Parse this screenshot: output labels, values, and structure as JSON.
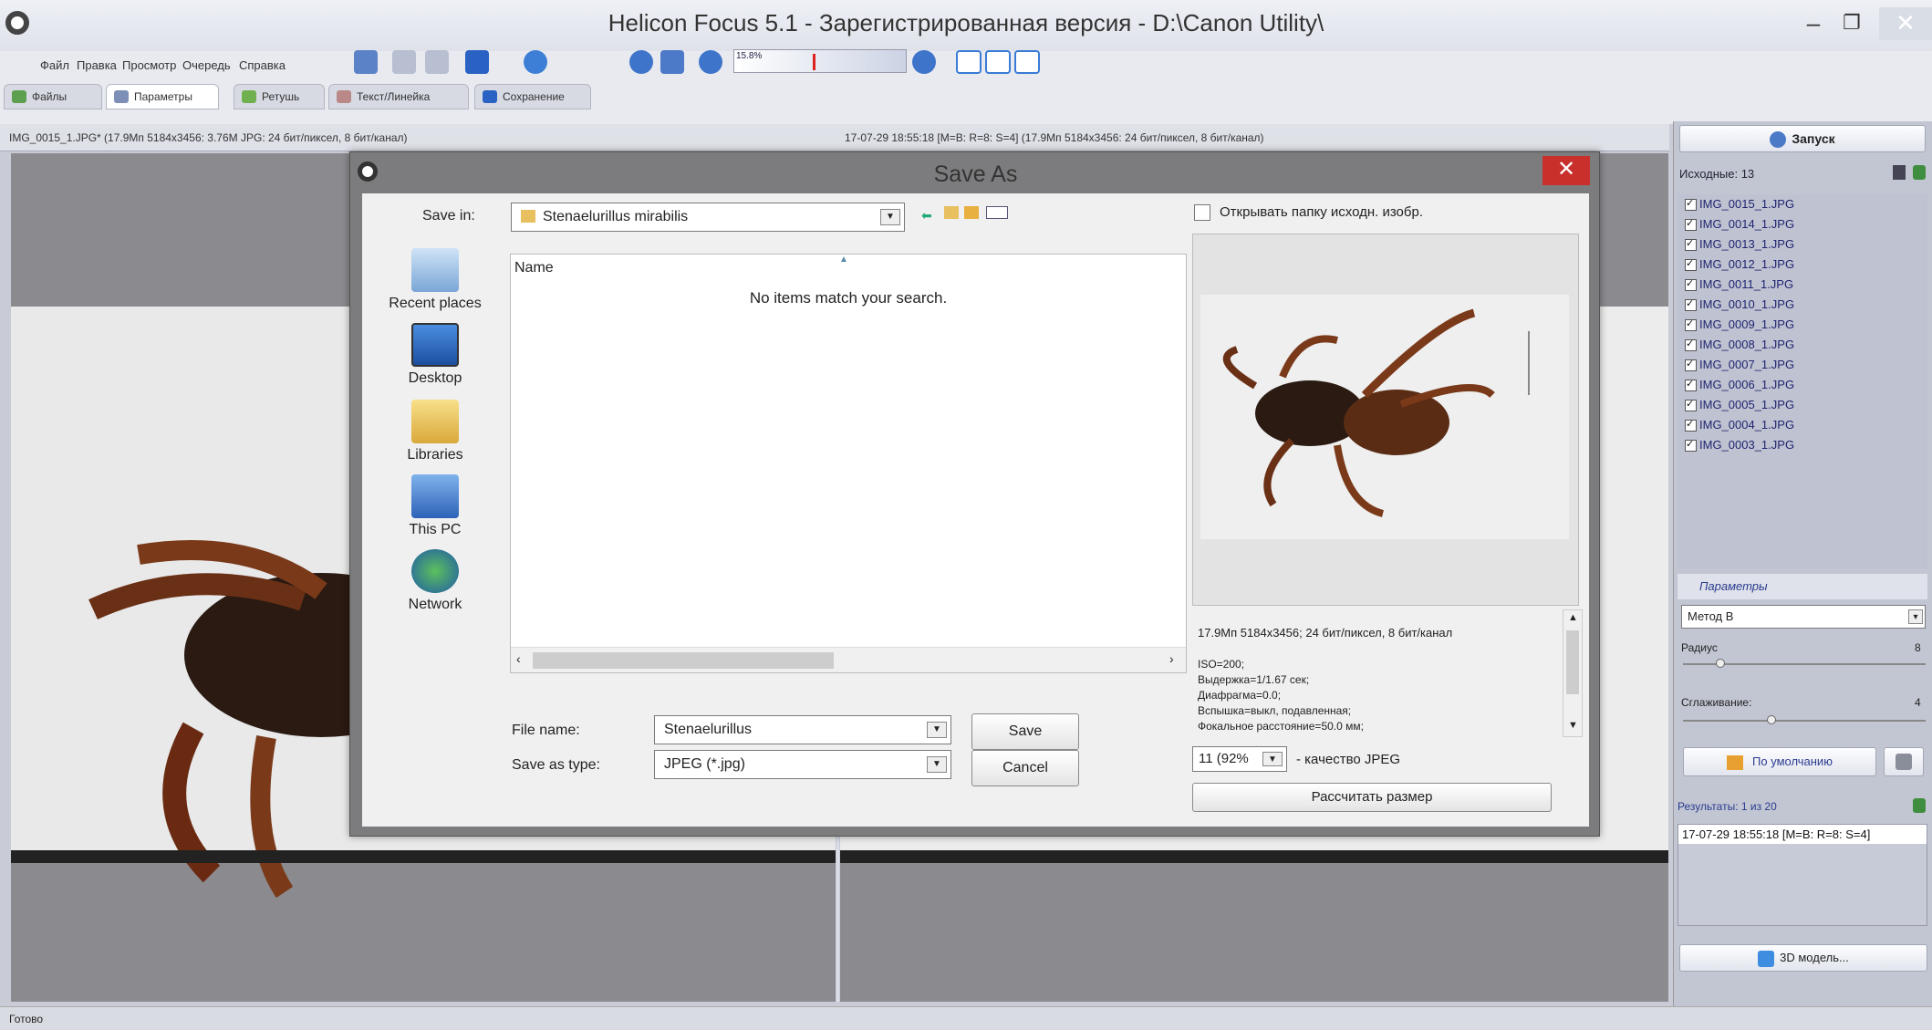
{
  "window": {
    "title": "Helicon Focus 5.1  -  Зарегистрированная версия - D:\\Canon Utility\\"
  },
  "menu": [
    "Файл",
    "Правка",
    "Просмотр",
    "Очередь",
    "Справка"
  ],
  "zoom": "15.8%",
  "tabs": [
    "Файлы",
    "Параметры",
    "Ретушь",
    "Текст/Линейка",
    "Сохранение"
  ],
  "info": {
    "left": "IMG_0015_1.JPG* (17.9Мп 5184x3456: 3.76M JPG: 24 бит/пиксел, 8 бит/канал)",
    "right": "17-07-29 18:55:18 [M=B: R=8: S=4] (17.9Мп 5184x3456: 24 бит/пиксел, 8 бит/канал)"
  },
  "right_panel": {
    "run_button": "Запуск",
    "sources_label": "Исходные: 13",
    "sources": [
      "IMG_0015_1.JPG",
      "IMG_0014_1.JPG",
      "IMG_0013_1.JPG",
      "IMG_0012_1.JPG",
      "IMG_0011_1.JPG",
      "IMG_0010_1.JPG",
      "IMG_0009_1.JPG",
      "IMG_0008_1.JPG",
      "IMG_0007_1.JPG",
      "IMG_0006_1.JPG",
      "IMG_0005_1.JPG",
      "IMG_0004_1.JPG",
      "IMG_0003_1.JPG"
    ],
    "params_header": "Параметры",
    "method": "Метод B",
    "radius_label": "Радиус",
    "radius_value": "8",
    "smoothing_label": "Сглаживание:",
    "smoothing_value": "4",
    "default_button": "По умолчанию",
    "results_label": "Результаты: 1 из 20",
    "results": [
      "17-07-29 18:55:18 [M=B: R=8: S=4]"
    ],
    "model_button": "3D модель..."
  },
  "status": "Готово",
  "dialog": {
    "title": "Save As",
    "save_in_label": "Save in:",
    "save_in_value": "Stenaelurillus mirabilis",
    "places": [
      "Recent places",
      "Desktop",
      "Libraries",
      "This PC",
      "Network"
    ],
    "column_name": "Name",
    "empty_message": "No items match your search.",
    "file_name_label": "File name:",
    "file_name_value": "Stenaelurillus",
    "save_as_type_label": "Save as type:",
    "save_as_type_value": "JPEG (*.jpg)",
    "save_button": "Save",
    "cancel_button": "Cancel",
    "open_folder_label": "Открывать папку исходн. изобр.",
    "info_line": "17.9Мп 5184x3456; 24 бит/пиксел, 8 бит/канал",
    "exif": [
      "ISO=200;",
      "Выдержка=1/1.67 сек;",
      "Диафрагма=0.0;",
      "Вспышка=выкл, подавленная;",
      "Фокальное расстояние=50.0 мм;"
    ],
    "quality_value": "11 (92%",
    "quality_label": "- качество JPEG",
    "calc_button": "Рассчитать размер"
  }
}
